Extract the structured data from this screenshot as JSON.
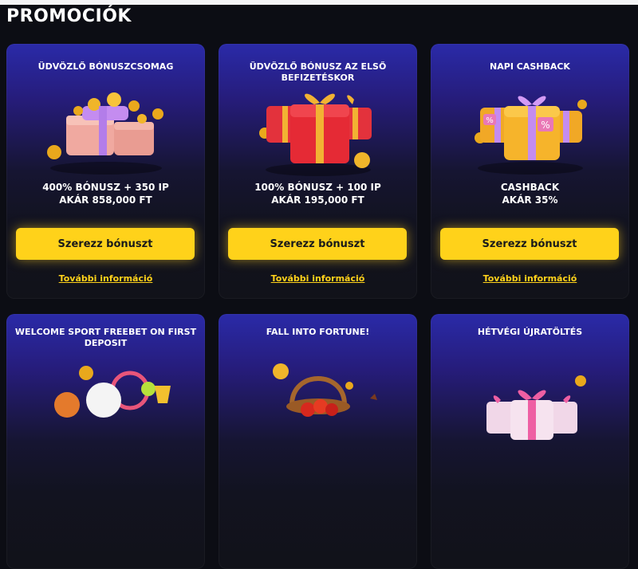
{
  "page": {
    "title": "PROMOCIÓK"
  },
  "promos": [
    {
      "title": "ÜDVÖZLŐ BÓNUSZCSOMAG",
      "offer_line1": "400% BÓNUSZ + 350 IP",
      "offer_line2": "AKÁR 858,000 FT",
      "button": "Szerezz bónuszt",
      "link": "További információ",
      "icon": "gift-boxes-coins-icon"
    },
    {
      "title": "ÜDVÖZLŐ BÓNUSZ AZ ELSŐ BEFIZETÉSKOR",
      "offer_line1": "100% BÓNUSZ + 100 IP",
      "offer_line2": "AKÁR 195,000 FT",
      "button": "Szerezz bónuszt",
      "link": "További információ",
      "icon": "red-gift-boxes-icon"
    },
    {
      "title": "NAPI CASHBACK",
      "offer_line1": "CASHBACK",
      "offer_line2": "AKÁR 35%",
      "button": "Szerezz bónuszt",
      "link": "További információ",
      "icon": "cashback-gifts-icon"
    },
    {
      "title": "WELCOME SPORT FREEBET ON FIRST DEPOSIT",
      "icon": "sport-balls-trophy-icon"
    },
    {
      "title": "FALL INTO FORTUNE!",
      "icon": "fruit-basket-icon"
    },
    {
      "title": "HÉTVÉGI ÚJRATÖLTÉS",
      "icon": "pink-gift-boxes-icon"
    }
  ],
  "colors": {
    "accent": "#ffd21a",
    "background": "#0c0d14",
    "card_top": "#2a2aa8",
    "card_bottom": "#111219"
  }
}
